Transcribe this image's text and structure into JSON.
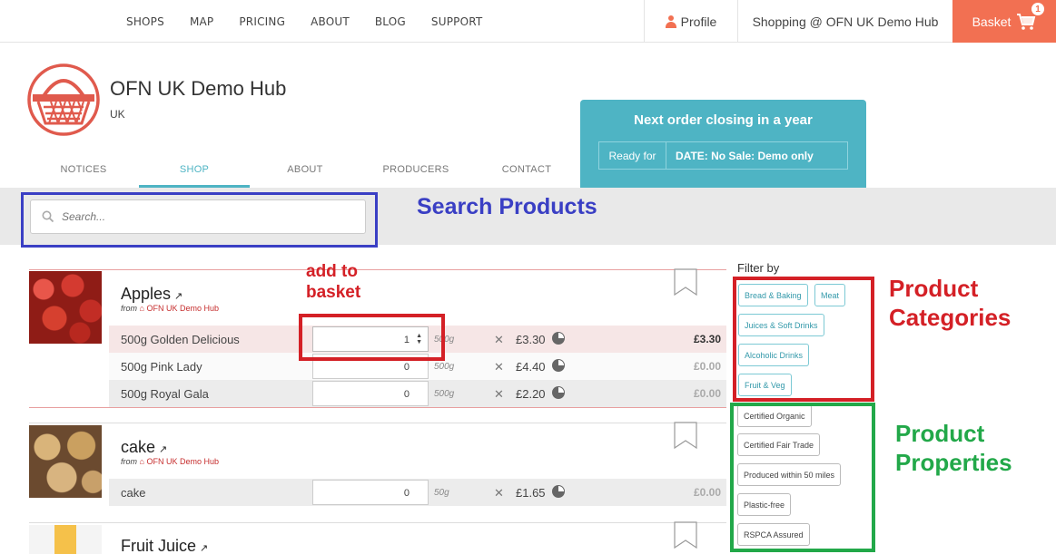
{
  "nav": {
    "links": [
      "SHOPS",
      "MAP",
      "PRICING",
      "ABOUT",
      "BLOG",
      "SUPPORT"
    ],
    "profile": "Profile",
    "shopping": "Shopping @ OFN UK Demo Hub",
    "basket": "Basket",
    "basket_count": "1"
  },
  "hub": {
    "name": "OFN UK Demo Hub",
    "country": "UK",
    "tabs": [
      "NOTICES",
      "SHOP",
      "ABOUT",
      "PRODUCERS",
      "CONTACT"
    ],
    "active_tab": "SHOP"
  },
  "order_cycle": {
    "title": "Next order closing in a year",
    "ready_label": "Ready for",
    "ready_value": "DATE: No Sale: Demo only"
  },
  "search": {
    "placeholder": "Search..."
  },
  "annotations": {
    "search": "Search Products",
    "basket": "add to\nbasket",
    "categories": "Product\nCategories",
    "properties": "Product\nProperties"
  },
  "products": [
    {
      "name": "Apples",
      "from": "from",
      "hub": "OFN UK Demo Hub",
      "variants": [
        {
          "name": "500g Golden Delicious",
          "qty": "1",
          "unit": "500g",
          "price": "£3.30",
          "total": "£3.30"
        },
        {
          "name": "500g Pink Lady",
          "qty": "0",
          "unit": "500g",
          "price": "£4.40",
          "total": "£0.00"
        },
        {
          "name": "500g Royal Gala",
          "qty": "0",
          "unit": "500g",
          "price": "£2.20",
          "total": "£0.00"
        }
      ]
    },
    {
      "name": "cake",
      "from": "from",
      "hub": "OFN UK Demo Hub",
      "variants": [
        {
          "name": "cake",
          "qty": "0",
          "unit": "50g",
          "price": "£1.65",
          "total": "£0.00"
        }
      ]
    },
    {
      "name": "Fruit Juice"
    }
  ],
  "filter": {
    "title": "Filter by",
    "categories": [
      "Bread & Baking",
      "Meat",
      "Juices & Soft Drinks",
      "Alcoholic Drinks",
      "Fruit & Veg"
    ],
    "properties": [
      "Certified Organic",
      "Certified Fair Trade",
      "Produced within 50 miles",
      "Plastic-free",
      "RSPCA Assured"
    ]
  },
  "colors": {
    "brand": "#f27052",
    "accent": "#4eb4c4",
    "annotation_blue": "#3a3fc4",
    "annotation_red": "#d42026",
    "annotation_green": "#22a849"
  }
}
